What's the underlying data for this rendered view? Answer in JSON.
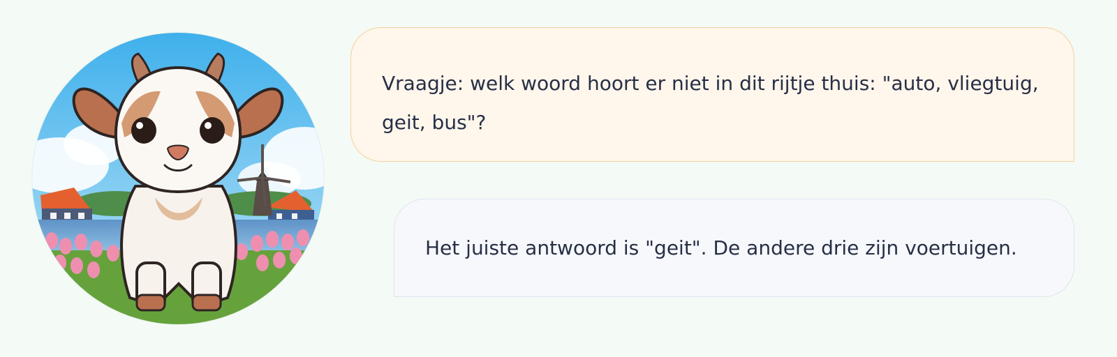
{
  "chat": {
    "avatar_icon": "goat-avatar-icon",
    "question": "Vraagje: welk woord hoort er niet in dit rijtje thuis: \"auto, vliegtuig, geit, bus\"?",
    "answer": "Het juiste antwoord is \"geit\". De andere drie zijn voertuigen."
  },
  "colors": {
    "page_background": "#f4faf5",
    "question_bubble": "#fff6ec",
    "question_border": "#f6cf9d",
    "answer_bubble": "#f7f8fb",
    "answer_border": "#e0e4ee",
    "text": "#262f45"
  }
}
